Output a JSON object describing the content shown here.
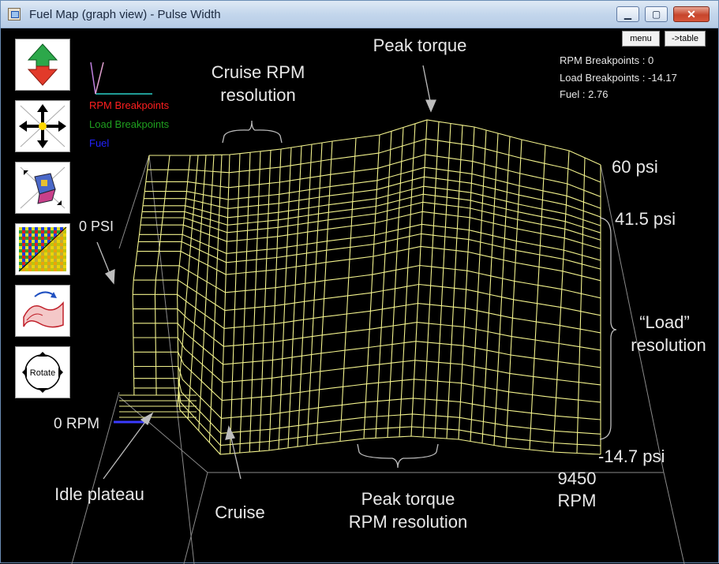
{
  "window": {
    "title": "Fuel Map (graph view) - Pulse Width",
    "minimize_glyph": "▁",
    "maximize_glyph": "▢",
    "close_glyph": "✕"
  },
  "toolbar": {
    "menu_label": "menu",
    "table_label": "->table",
    "rotate_label": "Rotate",
    "tools": [
      "up-down-arrow-icon",
      "move-cross-arrows-icon",
      "zoom-cube-icon",
      "color-map-icon",
      "redraw-surface-icon",
      "rotate-icon"
    ]
  },
  "readout": {
    "rpm": "RPM Breakpoints : 0",
    "load": "Load Breakpoints : -14.17",
    "fuel": "Fuel : 2.76"
  },
  "legend": {
    "rpm": "RPM Breakpoints",
    "load": "Load Breakpoints",
    "fuel": "Fuel",
    "colors": {
      "rpm": "#ff1f1f",
      "load": "#1fa01f",
      "fuel": "#2222ff"
    }
  },
  "annotations": {
    "peak_torque": "Peak torque",
    "cruise_rpm_line1": "Cruise RPM",
    "cruise_rpm_line2": "resolution",
    "load_60": "60 psi",
    "load_41": "41.5 psi",
    "load_res_line1": "“Load”",
    "load_res_line2": "resolution",
    "load_neg": "-14.7 psi",
    "zero_psi": "0 PSI",
    "zero_rpm": "0 RPM",
    "idle_plateau": "Idle plateau",
    "cruise": "Cruise",
    "peak_rpm_line1": "Peak torque",
    "peak_rpm_line2": "RPM resolution",
    "rpm_max_line1": "9450",
    "rpm_max_line2": "RPM"
  },
  "colors": {
    "mesh": "#f2f28c",
    "axes": "#8a8a8a",
    "background": "#000000"
  }
}
